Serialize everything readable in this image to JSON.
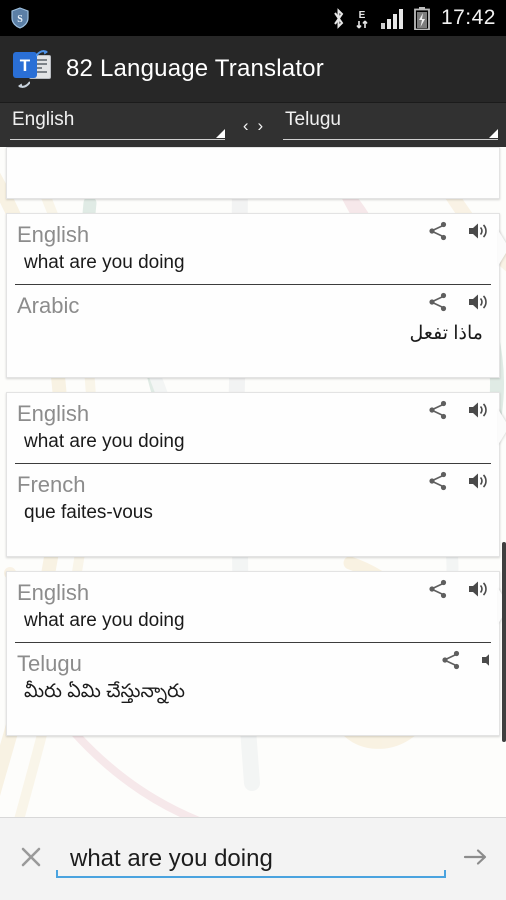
{
  "statusbar": {
    "icons": [
      "security-shield-icon",
      "bluetooth-icon",
      "edge-network-icon",
      "signal-bars-icon",
      "battery-charging-icon"
    ],
    "time": "17:42"
  },
  "appbar": {
    "app_icon": "translator-app-icon",
    "title": "82 Language Translator"
  },
  "language_selector": {
    "source": {
      "value": "English",
      "dropdown_icon": "spinner-triangle-icon"
    },
    "swap": {
      "left_icon": "‹",
      "right_icon": "›"
    },
    "target": {
      "value": "Telugu",
      "dropdown_icon": "spinner-triangle-icon"
    }
  },
  "history": {
    "cards": [
      {
        "source_language": "English",
        "source_text": "what are you doing",
        "target_language": "Arabic",
        "target_text": "ماذا تفعل",
        "rtl": true,
        "share_icon": "share-icon",
        "speak_icon": "speaker-icon"
      },
      {
        "source_language": "English",
        "source_text": "what are you doing",
        "target_language": "French",
        "target_text": "que faites-vous",
        "rtl": false,
        "share_icon": "share-icon",
        "speak_icon": "speaker-icon"
      },
      {
        "source_language": "English",
        "source_text": "what are you doing",
        "target_language": "Telugu",
        "target_text": "మీరు ఏమి చేస్తున్నారు",
        "rtl": false,
        "share_icon": "share-icon",
        "speak_icon": "speaker-icon"
      }
    ]
  },
  "input_bar": {
    "clear_icon": "close-x-icon",
    "value": "what are you doing",
    "placeholder": "",
    "send_icon": "arrow-right-icon"
  },
  "colors": {
    "statusbar_bg": "#000000",
    "actionbar_bg": "#272727",
    "langbar_bg": "#313131",
    "accent_underline": "#4aa3df",
    "app_icon_blue": "#2a6fd6",
    "lang_label": "#8c8c8c",
    "body_text": "#1a1a1a"
  }
}
